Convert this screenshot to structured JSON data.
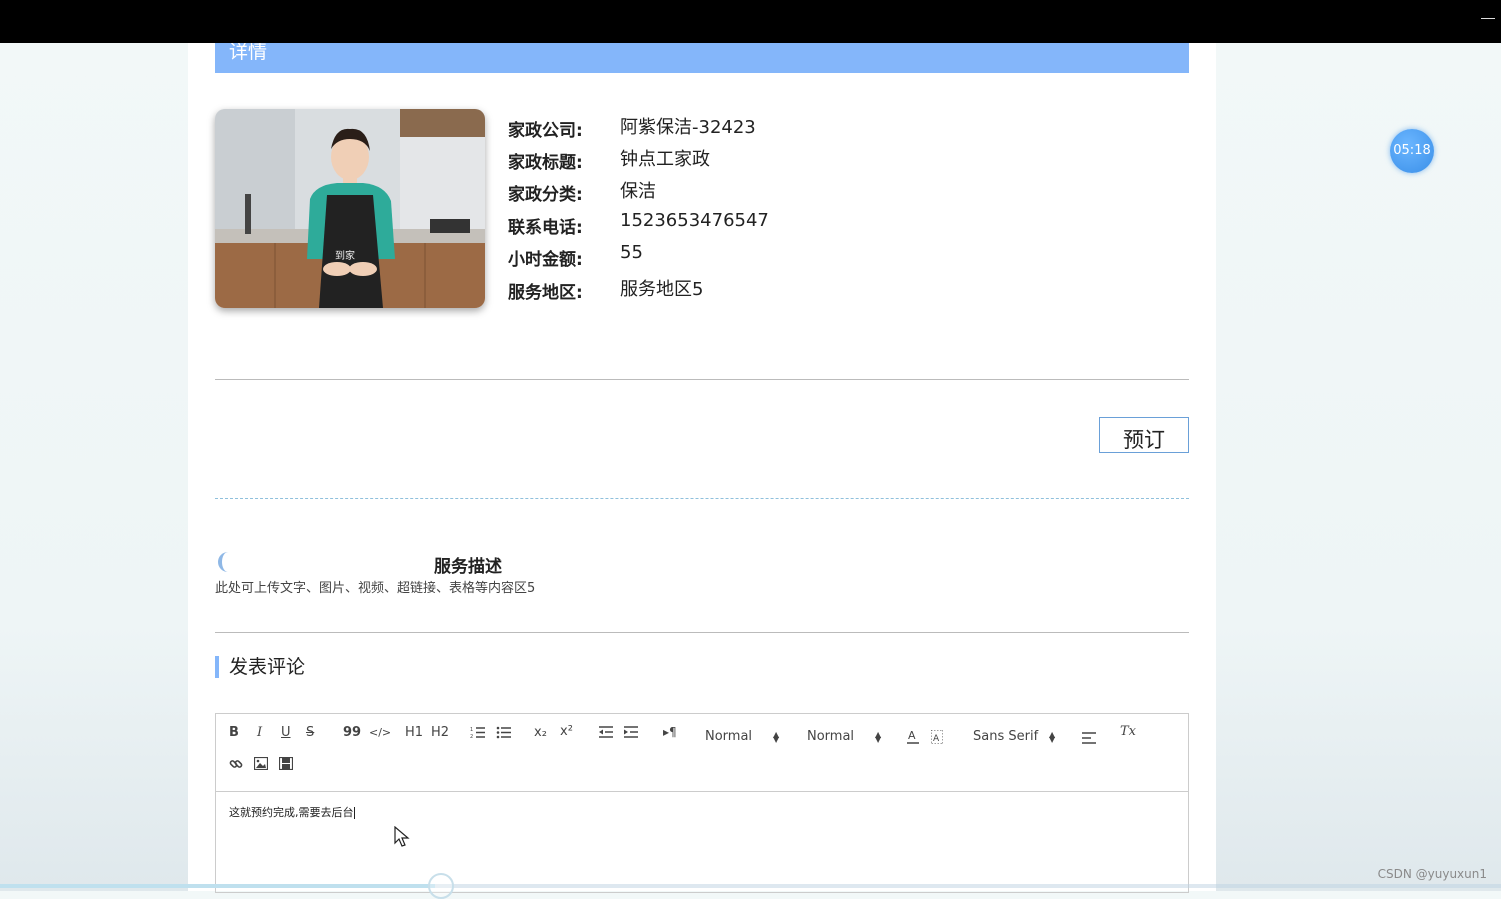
{
  "header": {
    "title": "详情"
  },
  "timer": {
    "value": "05:18"
  },
  "details": [
    {
      "label": "家政公司:",
      "value": "阿紫保洁-32423"
    },
    {
      "label": "家政标题:",
      "value": "钟点工家政"
    },
    {
      "label": "家政分类:",
      "value": "保洁"
    },
    {
      "label": "联系电话:",
      "value": "1523653476547"
    },
    {
      "label": "小时金额:",
      "value": "55"
    },
    {
      "label": "服务地区:",
      "value": "服务地区5"
    }
  ],
  "actions": {
    "book_label": "预订"
  },
  "description": {
    "title": "服务描述",
    "text": "此处可上传文字、图片、视频、超链接、表格等内容区5"
  },
  "comment": {
    "title": "发表评论",
    "toolbar": {
      "bold": "B",
      "italic": "I",
      "underline": "U",
      "strike": "S",
      "blockquote": "99",
      "code": "</>",
      "h1": "H1",
      "h2": "H2",
      "subscript": "x₂",
      "superscript": "x²",
      "direction": "▸¶",
      "header_picker": "Normal",
      "size_picker": "Normal",
      "font_picker": "Sans Serif",
      "clean": "Tx"
    },
    "content": "这就预约完成,需要去后台"
  },
  "video": {
    "progress": 0.29
  },
  "watermark": "CSDN @yuyuxun1"
}
